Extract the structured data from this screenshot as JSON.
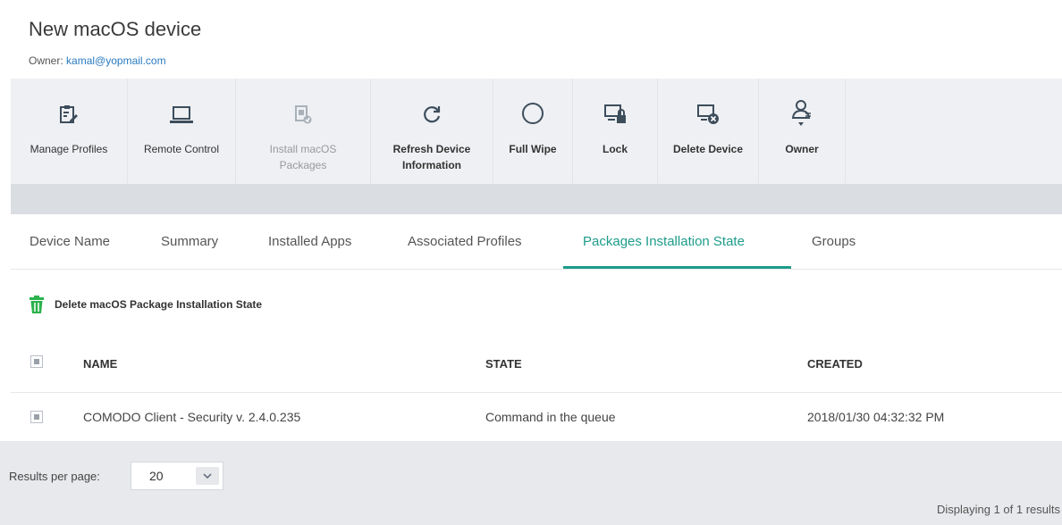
{
  "header": {
    "title": "New macOS device",
    "owner_prefix": "Owner:",
    "owner_email": "kamal@yopmail.com"
  },
  "toolbar": {
    "manage_profiles": "Manage Profiles",
    "remote_control": "Remote Control",
    "install_packages_1": "Install macOS",
    "install_packages_2": "Packages",
    "refresh_1": "Refresh Device",
    "refresh_2": "Information",
    "full_wipe": "Full Wipe",
    "lock": "Lock",
    "delete_device": "Delete Device",
    "owner": "Owner"
  },
  "tabs": {
    "device_name": "Device Name",
    "summary": "Summary",
    "installed_apps": "Installed Apps",
    "associated_profiles": "Associated Profiles",
    "packages_installation_state": "Packages Installation State",
    "groups": "Groups"
  },
  "actions": {
    "delete_state": "Delete macOS Package Installation State"
  },
  "table": {
    "columns": {
      "name": "NAME",
      "state": "STATE",
      "created": "CREATED"
    },
    "rows": [
      {
        "name": "COMODO Client - Security v. 2.4.0.235",
        "state": "Command in the queue",
        "created": "2018/01/30 04:32:32 PM"
      }
    ]
  },
  "footer": {
    "results_per_page_label": "Results per page:",
    "results_per_page_value": "20",
    "displaying": "Displaying 1 of 1 results"
  },
  "colors": {
    "accent": "#1d9c8a",
    "link": "#2a7ac0",
    "trash_icon": "#2bb24c"
  }
}
